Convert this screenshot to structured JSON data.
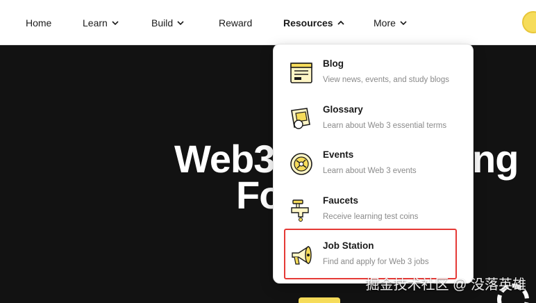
{
  "nav": {
    "items": [
      {
        "label": "Home",
        "has_chevron": false,
        "chevron": ""
      },
      {
        "label": "Learn",
        "has_chevron": true,
        "chevron": "down"
      },
      {
        "label": "Build",
        "has_chevron": true,
        "chevron": "down"
      },
      {
        "label": "Reward",
        "has_chevron": false,
        "chevron": ""
      },
      {
        "label": "Resources",
        "has_chevron": true,
        "chevron": "up",
        "active": true
      },
      {
        "label": "More",
        "has_chevron": true,
        "chevron": "down"
      }
    ],
    "logo_icon": "coin-logo-icon"
  },
  "hero": {
    "line1_left": "Web3",
    "line1_right": "ng",
    "line2_left": "Fo"
  },
  "dropdown": {
    "items": [
      {
        "title": "Blog",
        "desc": "View news, events, and study blogs",
        "icon": "blog-icon"
      },
      {
        "title": "Glossary",
        "desc": "Learn about Web 3 essential terms",
        "icon": "glossary-icon"
      },
      {
        "title": "Events",
        "desc": "Learn about Web 3 events",
        "icon": "events-icon"
      },
      {
        "title": "Faucets",
        "desc": "Receive learning test coins",
        "icon": "faucets-icon"
      },
      {
        "title": "Job Station",
        "desc": "Find and apply for Web 3 jobs",
        "icon": "megaphone-icon"
      }
    ]
  },
  "watermark": "掘金技术社区 @ 没落英雄",
  "colors": {
    "accent_yellow": "#f6dc5a",
    "highlight_red": "#e53935",
    "hero_bg": "#121212"
  }
}
